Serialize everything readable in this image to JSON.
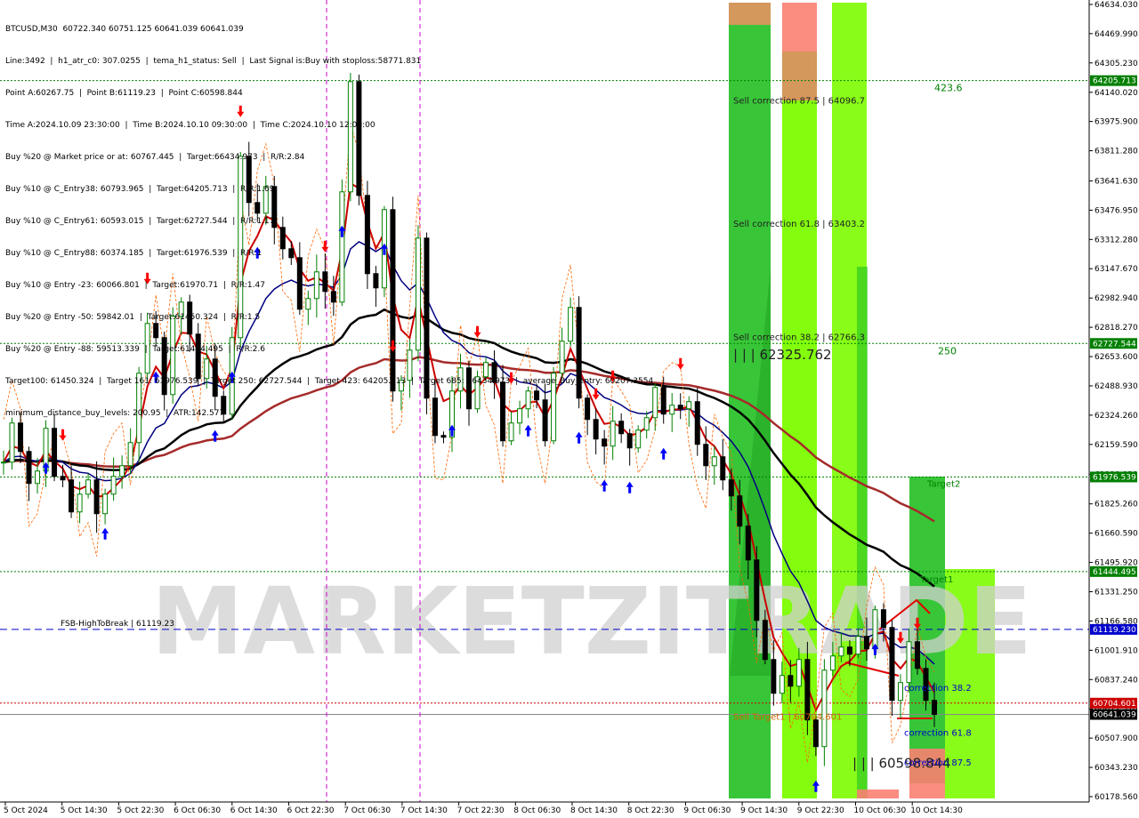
{
  "info_lines": [
    "BTCUSD,M30  60722.340 60751.125 60641.039 60641.039",
    "Line:3492  |  h1_atr_c0: 307.0255  |  tema_h1_status: Sell  |  Last Signal is:Buy with stoploss:58771.831",
    "Point A:60267.75  |  Point B:61119.23  |  Point C:60598.844",
    "Time A:2024.10.09 23:30:00  |  Time B:2024.10.10 09:30:00  |  Time C:2024.10.10 12:00:00",
    "Buy %20 @ Market price or at: 60767.445  |  Target:66434.973  |  R/R:2.84",
    "Buy %10 @ C_Entry38: 60793.965  |  Target:64205.713  |  R/R:1.69",
    "Buy %10 @ C_Entry61: 60593.015  |  Target:62727.544  |  R/R:1.17",
    "Buy %10 @ C_Entry88: 60374.185  |  Target:61976.539  |  R/R:1",
    "Buy %10 @ Entry -23: 60066.801  |  Target:61970.71  |  R/R:1.47",
    "Buy %20 @ Entry -50: 59842.01  |  Target:61450.324  |  R/R:1.5",
    "Buy %20 @ Entry -88: 59513.339  |  Target:61444.495  |  R/R:2.6",
    "Target100: 61450.324  |  Target 161: 61976.539  |  Target 250: 62727.544  |  Target 423: 64205.713  |  Target 685: 66434.973  |  average_Buy_entry: 60207.3554",
    "minimum_distance_buy_levels: 200.95  |  ATR:142.577"
  ],
  "watermark": "MARKETZITRADE",
  "colors": {
    "bull": "#008000",
    "bear": "#000000",
    "ema_red": "#cc0000",
    "ma_blue": "#000080",
    "ma_black": "#000000",
    "ma_brown": "#a52a2a",
    "green_band": "#22c022",
    "lime_band": "#7cfc00",
    "salmon": "#fa8072",
    "tan": "#cd853f",
    "hline_green": "#008000",
    "fsb_blue": "#0000cc",
    "price_red": "#cc0000"
  },
  "chart_data": {
    "type": "candlestick",
    "symbol": "BTCUSD",
    "timeframe": "M30",
    "last_price": "60641.039",
    "ylim": [
      60178.56,
      64634.03
    ],
    "y_ticks": [
      "64634.030",
      "64469.990",
      "64305.230",
      "64140.020",
      "63975.900",
      "63811.280",
      "63641.630",
      "63476.950",
      "63312.280",
      "63147.670",
      "62982.940",
      "62818.270",
      "62653.600",
      "62488.930",
      "62324.260",
      "62159.590",
      "61990.920",
      "61825.260",
      "61660.590",
      "61495.920",
      "61331.250",
      "61166.580",
      "61001.910",
      "60837.240",
      "60672.570",
      "60507.900",
      "60343.230",
      "60178.560"
    ],
    "x_ticks": [
      "5 Oct 2024",
      "5 Oct 14:30",
      "5 Oct 22:30",
      "6 Oct 06:30",
      "6 Oct 14:30",
      "6 Oct 22:30",
      "7 Oct 06:30",
      "7 Oct 14:30",
      "7 Oct 22:30",
      "8 Oct 06:30",
      "8 Oct 14:30",
      "8 Oct 22:30",
      "9 Oct 06:30",
      "9 Oct 14:30",
      "9 Oct 22:30",
      "10 Oct 06:30",
      "10 Oct 14:30"
    ],
    "price_labels": [
      {
        "value": 64205.713,
        "text": "64205.713",
        "color": "#008000"
      },
      {
        "value": 62727.544,
        "text": "62727.544",
        "color": "#008000"
      },
      {
        "value": 61976.539,
        "text": "61976.539",
        "color": "#008000"
      },
      {
        "value": 61444.495,
        "text": "61444.495",
        "color": "#008000"
      },
      {
        "value": 61119.23,
        "text": "61119.230",
        "color": "#0000cc"
      },
      {
        "value": 60704.601,
        "text": "60704.601",
        "color": "#cc0000"
      },
      {
        "value": 60641.039,
        "text": "60641.039",
        "color": "#000000"
      }
    ],
    "h_levels": [
      {
        "value": 64205.713,
        "color": "#008000",
        "style": "dotted",
        "label": "423.6"
      },
      {
        "value": 62727.544,
        "color": "#008000",
        "style": "dotted",
        "label": "250"
      },
      {
        "value": 61976.539,
        "color": "#008000",
        "style": "dotted",
        "label": "Target2"
      },
      {
        "value": 61444.495,
        "color": "#008000",
        "style": "dotted",
        "label": "Target1"
      },
      {
        "value": 61119.23,
        "color": "#0000cc",
        "style": "dashed",
        "label": "FSB-HighToBreak | 61119.23"
      },
      {
        "value": 60704.601,
        "color": "#cc0000",
        "style": "dotted",
        "label": ""
      },
      {
        "value": 60641.039,
        "color": "#888888",
        "style": "solid",
        "label": ""
      }
    ],
    "annotations": [
      {
        "text": "Sell correction 87.5 | 64096.7",
        "x": "9 Oct 14:30",
        "y": 64096.7
      },
      {
        "text": "Sell correction 61.8 | 63403.2",
        "x": "9 Oct 14:30",
        "y": 63403.2
      },
      {
        "text": "Sell correction 38.2 | 62766.3",
        "x": "9 Oct 14:30",
        "y": 62766.3
      },
      {
        "text": "| | | 62325.762",
        "x": "9 Oct 14:30",
        "y": 62660
      },
      {
        "text": "Sell Target1 | 60704.601",
        "x": "9 Oct 14:30",
        "y": 60630
      },
      {
        "text": "| | | 60598.844",
        "x": "10 Oct 06:30",
        "y": 60360
      },
      {
        "text": "correction 38.2",
        "x": "10 Oct 14:30",
        "y": 60793.965
      },
      {
        "text": "correction 61.8",
        "x": "10 Oct 14:30",
        "y": 60540
      },
      {
        "text": "correction 87.5",
        "x": "10 Oct 14:30",
        "y": 60374.185
      }
    ],
    "ohlc_seed_path": [
      62060,
      62280,
      62120,
      61940,
      62010,
      62250,
      61980,
      61960,
      61780,
      61880,
      61960,
      61770,
      61880,
      61980,
      62040,
      62170,
      62560,
      62840,
      62760,
      62440,
      62880,
      62960,
      62780,
      62530,
      62640,
      62430,
      62330,
      62760,
      63780,
      63520,
      63460,
      63610,
      63380,
      63260,
      63210,
      62920,
      62980,
      63130,
      63020,
      62960,
      63580,
      64200,
      63560,
      63120,
      63040,
      63480,
      62460,
      62520,
      62690,
      63320,
      62420,
      62210,
      62200,
      62460,
      62590,
      62360,
      62540,
      62620,
      62510,
      62180,
      62280,
      62360,
      62460,
      62410,
      62180,
      62560,
      62740,
      62930,
      62420,
      62300,
      62190,
      62150,
      62290,
      62220,
      62140,
      62240,
      62310,
      62480,
      62330,
      62380,
      62360,
      62400,
      62160,
      62040,
      62090,
      61960,
      61870,
      61700,
      61510,
      61170,
      60950,
      60760,
      60860,
      60800,
      60950,
      60610,
      60460,
      60890,
      60970,
      61020,
      60980,
      61080,
      61010,
      61230,
      61130,
      60720,
      60820,
      61050,
      60900,
      60720,
      60641
    ]
  }
}
